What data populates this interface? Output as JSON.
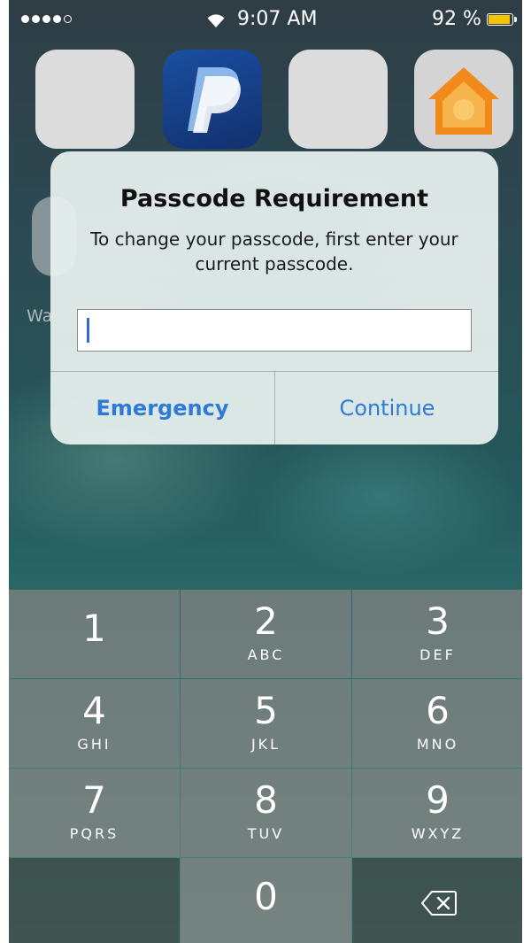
{
  "status_bar": {
    "signal_dots_filled": 4,
    "signal_dots_total": 5,
    "wifi_icon": "wifi-icon",
    "time": "9:07 AM",
    "battery_percent_text": "92 %",
    "battery_level": 0.92,
    "battery_color": "#f4c400"
  },
  "home_screen": {
    "apps": [
      {
        "icon": "blank-app-icon"
      },
      {
        "icon": "paypal-icon"
      },
      {
        "icon": "blank-app-icon"
      },
      {
        "icon": "home-icon"
      }
    ],
    "partial_label": "Wa"
  },
  "alert": {
    "title": "Passcode Requirement",
    "message": "To change your passcode, first enter your current passcode.",
    "input_value": "",
    "buttons": {
      "emergency": "Emergency",
      "continue": "Continue"
    },
    "button_color": "#2f7ad6"
  },
  "keypad": {
    "keys": [
      {
        "digit": "1",
        "letters": ""
      },
      {
        "digit": "2",
        "letters": "ABC"
      },
      {
        "digit": "3",
        "letters": "DEF"
      },
      {
        "digit": "4",
        "letters": "GHI"
      },
      {
        "digit": "5",
        "letters": "JKL"
      },
      {
        "digit": "6",
        "letters": "MNO"
      },
      {
        "digit": "7",
        "letters": "PQRS"
      },
      {
        "digit": "8",
        "letters": "TUV"
      },
      {
        "digit": "9",
        "letters": "WXYZ"
      },
      {
        "digit": "0",
        "letters": ""
      }
    ],
    "backspace_icon": "backspace-icon"
  }
}
